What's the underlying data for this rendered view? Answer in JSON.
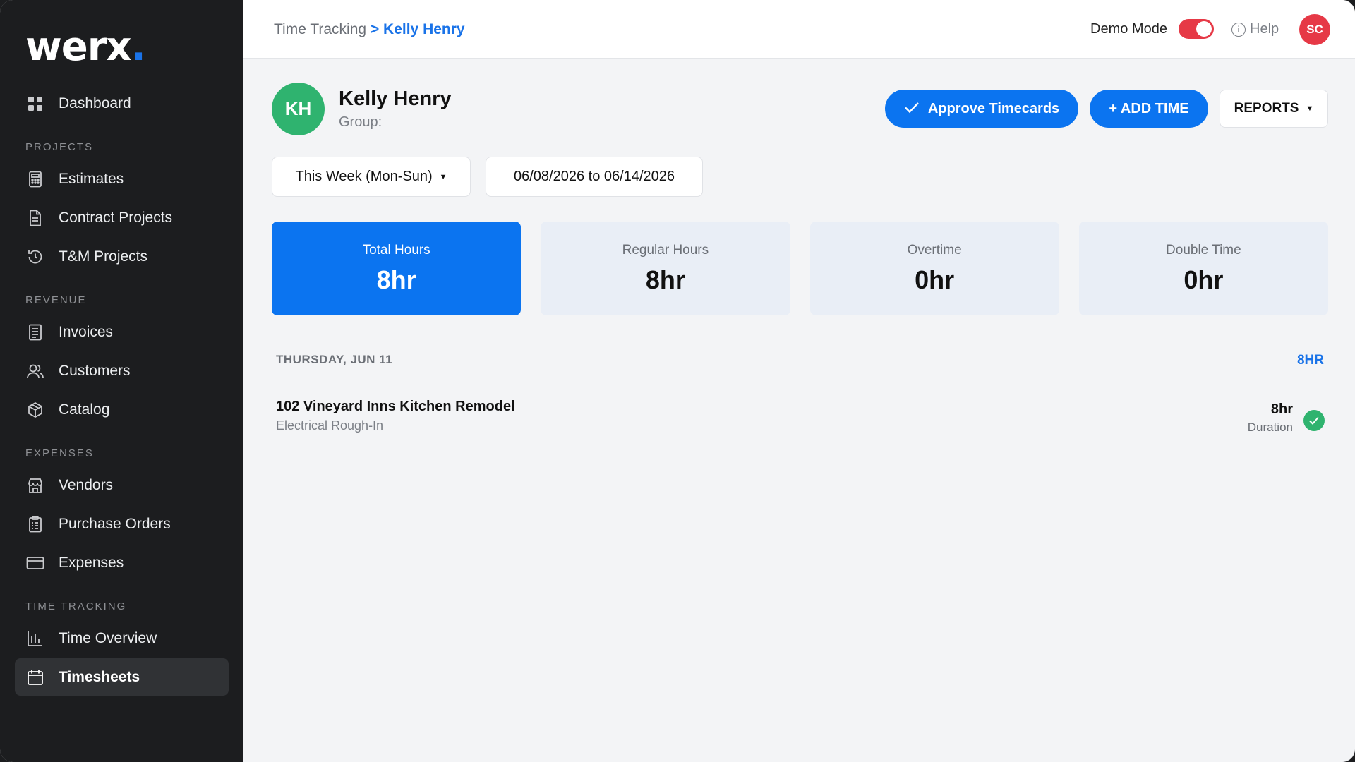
{
  "app": {
    "logo": "werx",
    "logo_dot": "."
  },
  "sidebar": {
    "items": [
      {
        "label": "Dashboard",
        "icon": "grid-icon"
      },
      {
        "section": "PROJECTS"
      },
      {
        "label": "Estimates",
        "icon": "calculator-icon"
      },
      {
        "label": "Contract Projects",
        "icon": "document-icon"
      },
      {
        "label": "T&M Projects",
        "icon": "history-icon"
      },
      {
        "section": "REVENUE"
      },
      {
        "label": "Invoices",
        "icon": "invoice-icon"
      },
      {
        "label": "Customers",
        "icon": "users-icon"
      },
      {
        "label": "Catalog",
        "icon": "box-icon"
      },
      {
        "section": "EXPENSES"
      },
      {
        "label": "Vendors",
        "icon": "store-icon"
      },
      {
        "label": "Purchase Orders",
        "icon": "clipboard-icon"
      },
      {
        "label": "Expenses",
        "icon": "card-icon"
      },
      {
        "section": "TIME TRACKING"
      },
      {
        "label": "Time Overview",
        "icon": "bar-chart-icon"
      },
      {
        "label": "Timesheets",
        "icon": "calendar-icon",
        "active": true
      }
    ]
  },
  "topbar": {
    "breadcrumb_root": "Time Tracking",
    "breadcrumb_sep": ">",
    "breadcrumb_current": "Kelly Henry",
    "demo_label": "Demo Mode",
    "demo_on": true,
    "help_label": "Help",
    "avatar_initials": "SC"
  },
  "user": {
    "initials": "KH",
    "name": "Kelly Henry",
    "group": "Group:"
  },
  "actions": {
    "approve_label": "Approve Timecards",
    "add_label": "+ ADD TIME",
    "reports_label": "REPORTS"
  },
  "filters": {
    "period": "This Week (Mon-Sun)",
    "date_range": "06/08/2026 to 06/14/2026"
  },
  "cards": [
    {
      "label": "Total Hours",
      "value": "8hr"
    },
    {
      "label": "Regular Hours",
      "value": "8hr"
    },
    {
      "label": "Overtime",
      "value": "0hr"
    },
    {
      "label": "Double Time",
      "value": "0hr"
    }
  ],
  "day": {
    "title": "THURSDAY, JUN 11",
    "total": "8HR",
    "entries": [
      {
        "project": "102 Vineyard Inns Kitchen Remodel",
        "task": "Electrical Rough-In",
        "duration": "8hr",
        "duration_label": "Duration"
      }
    ]
  },
  "colors": {
    "accent": "#0b74f0",
    "sidebar": "#1c1d1f",
    "success": "#2fb36f",
    "danger": "#e63946"
  }
}
